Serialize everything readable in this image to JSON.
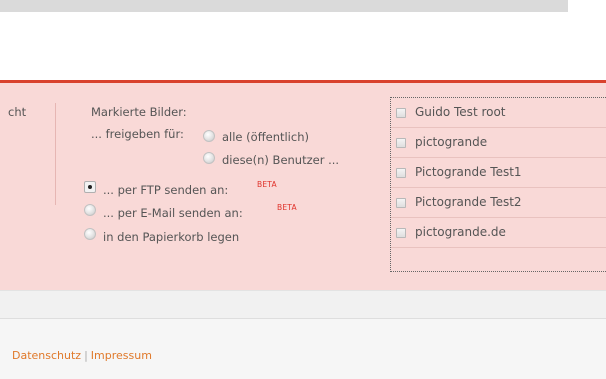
{
  "left_tab_label": "cht",
  "marked_images": {
    "title": "Markierte Bilder:",
    "share_label": "... freigeben für:",
    "share_options": [
      "alle (öffentlich)",
      "diese(n) Benutzer ..."
    ],
    "actions": [
      {
        "label": "... per FTP senden an:",
        "badge": "BETA",
        "selected": true
      },
      {
        "label": "... per E-Mail senden an:",
        "badge": "BETA",
        "selected": false
      },
      {
        "label": "in den Papierkorb legen",
        "badge": "",
        "selected": false
      }
    ]
  },
  "users": [
    "Guido Test root",
    "pictogrande",
    "Pictogrande Test1",
    "Pictogrande Test2",
    "pictogrande.de"
  ],
  "footer": {
    "links": [
      "Datenschutz",
      "Impressum"
    ],
    "separator": "|"
  },
  "colors": {
    "accent_red": "#d9422d",
    "pink_background": "#f9d9d7",
    "link_orange": "#e0792a",
    "beta_red": "#e0332b"
  }
}
